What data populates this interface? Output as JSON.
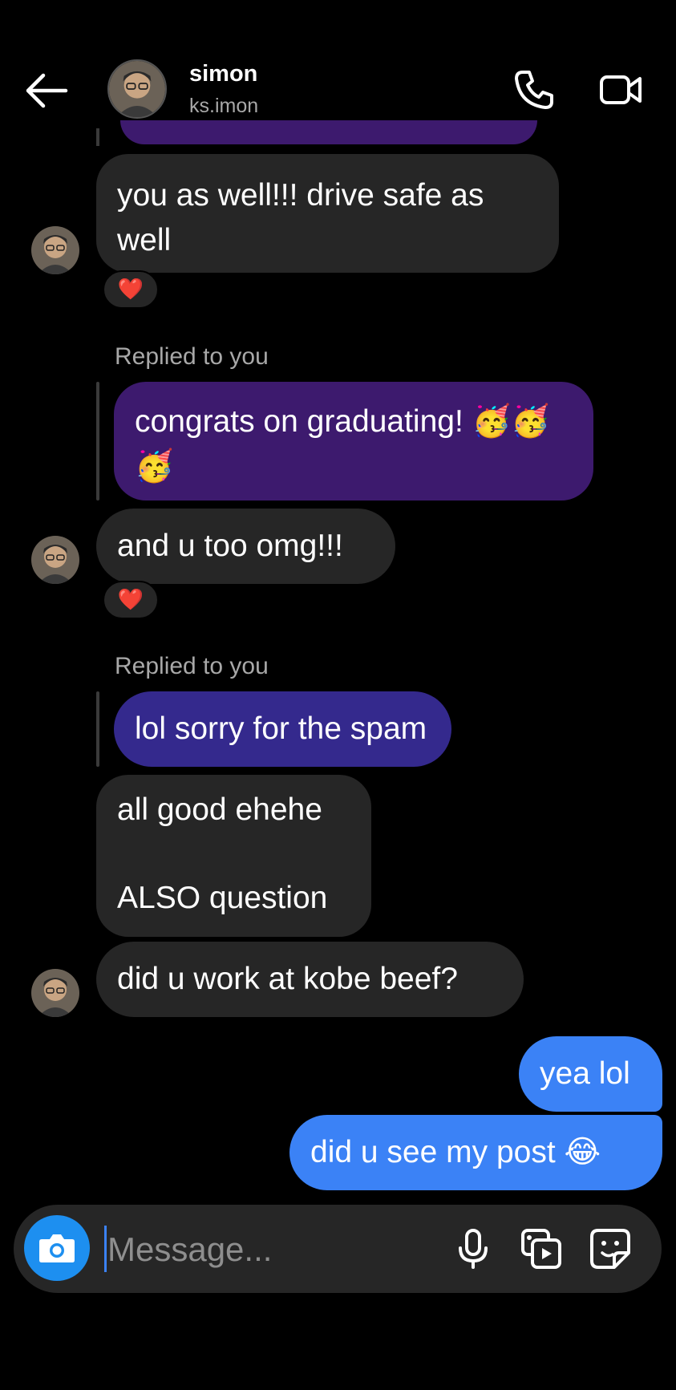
{
  "header": {
    "name": "simon",
    "handle": "ks.imon"
  },
  "messages": {
    "m1": "you as well!!! drive safe as well",
    "m1_reaction": "❤️",
    "reply1_label": "Replied to you",
    "reply1_quote": "congrats on graduating! 🥳🥳🥳",
    "m2": "and u too omg!!!",
    "m2_reaction": "❤️",
    "reply2_label": "Replied to you",
    "reply2_quote": "lol sorry for the spam",
    "m3_line1": "all good ehehe",
    "m3_line2": "ALSO question",
    "m4": "did u work at kobe beef?",
    "s1": "yea lol",
    "s2": "did u see my post 😂"
  },
  "composer": {
    "placeholder": "Message..."
  },
  "colors": {
    "sent_bubble": "#3b82f6",
    "received_bubble": "#262626",
    "reply_quote_purple": "#3d1a6e",
    "reply_quote_indigo": "#34298d",
    "camera_button": "#1d8ff0"
  }
}
